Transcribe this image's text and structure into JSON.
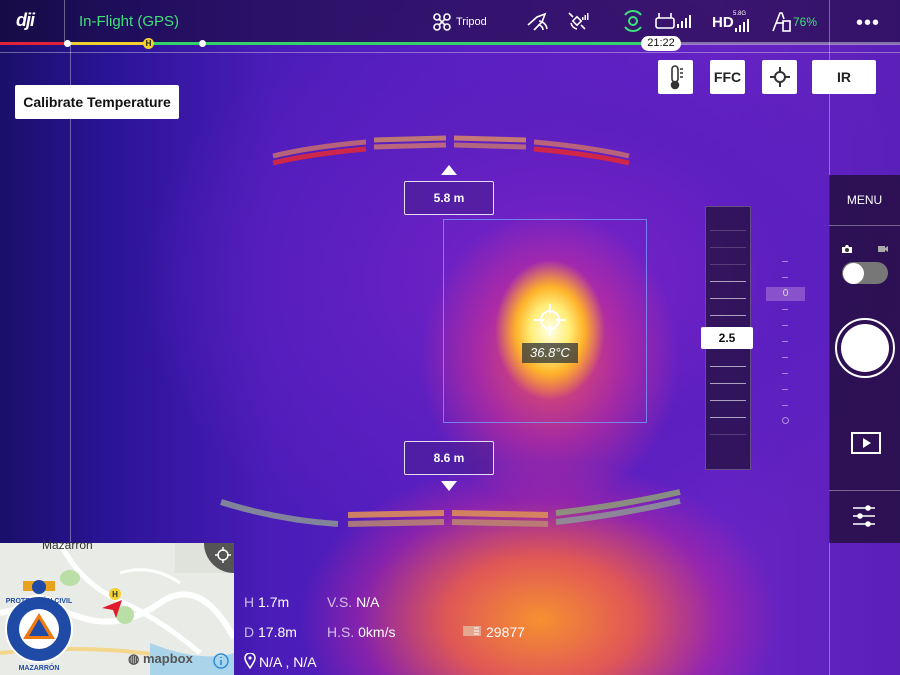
{
  "topbar": {
    "logo": "dji",
    "flight_status": "In-Flight (GPS)",
    "flight_mode": "Tripod",
    "video_link": "HD",
    "video_link_band": "5.8G",
    "battery_percent": "76%",
    "time_remaining": "21:22",
    "more_icon": "more-icon"
  },
  "calibrate_button": "Calibrate Temperature",
  "camera_buttons": {
    "ffc": "FFC",
    "ir": "IR",
    "thermometer_icon": "thermometer-icon",
    "spot_meter_icon": "crosshair-icon"
  },
  "distances": {
    "upper": "5.8 m",
    "lower": "8.6 m"
  },
  "spot_temperature": "36.8°C",
  "zoom": {
    "value": "2.5"
  },
  "gimbal": {
    "value": "0"
  },
  "right_panel": {
    "menu": "MENU",
    "mode": "photo",
    "playback_icon": "playback-icon",
    "settings_icon": "settings-sliders-icon"
  },
  "map": {
    "town": "Mazarrón",
    "provider": "mapbox",
    "seal_text_top": "PROTECCIÓN CIVIL",
    "seal_text_bottom": "MAZARRÓN"
  },
  "telemetry": {
    "h_label": "H",
    "h_value": "1.7m",
    "vs_label": "V.S.",
    "vs_value": "N/A",
    "d_label": "D",
    "d_value": "17.8m",
    "hs_label": "H.S.",
    "hs_value": "0km/s",
    "storage_value": "29877",
    "location": "N/A , N/A"
  },
  "colors": {
    "status_green": "#3ee07a",
    "progress_red": "#e0233a",
    "progress_yellow": "#f2d030",
    "progress_green": "#34d36a"
  }
}
